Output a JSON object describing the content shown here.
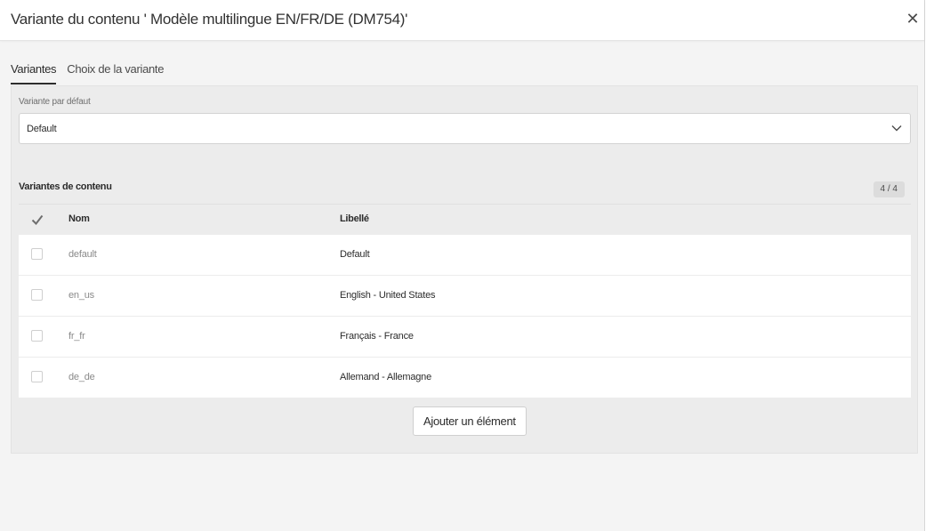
{
  "dialog": {
    "title": "Variante du contenu ' Modèle multilingue EN/FR/DE (DM754)'",
    "close_icon": "close-icon"
  },
  "tabs": [
    {
      "label": "Variantes",
      "active": true
    },
    {
      "label": "Choix de la variante",
      "active": false
    }
  ],
  "default_variant": {
    "label": "Variante par défaut",
    "value": "Default",
    "icon": "chevron-down-icon"
  },
  "content_variants": {
    "title": "Variantes de contenu",
    "count": "4 / 4",
    "columns": {
      "check_icon": "checkmark-icon",
      "nom": "Nom",
      "libelle": "Libellé"
    },
    "rows": [
      {
        "nom": "default",
        "libelle": "Default"
      },
      {
        "nom": "en_us",
        "libelle": "English - United States"
      },
      {
        "nom": "fr_fr",
        "libelle": "Français - France"
      },
      {
        "nom": "de_de",
        "libelle": "Allemand - Allemagne"
      }
    ]
  },
  "add_button": {
    "label": "Ajouter un élément"
  },
  "colors": {
    "panel_bg": "#ececec",
    "dialog_bg": "#f4f4f4",
    "text": "#2c2c2c",
    "muted": "#8a8a8a"
  }
}
